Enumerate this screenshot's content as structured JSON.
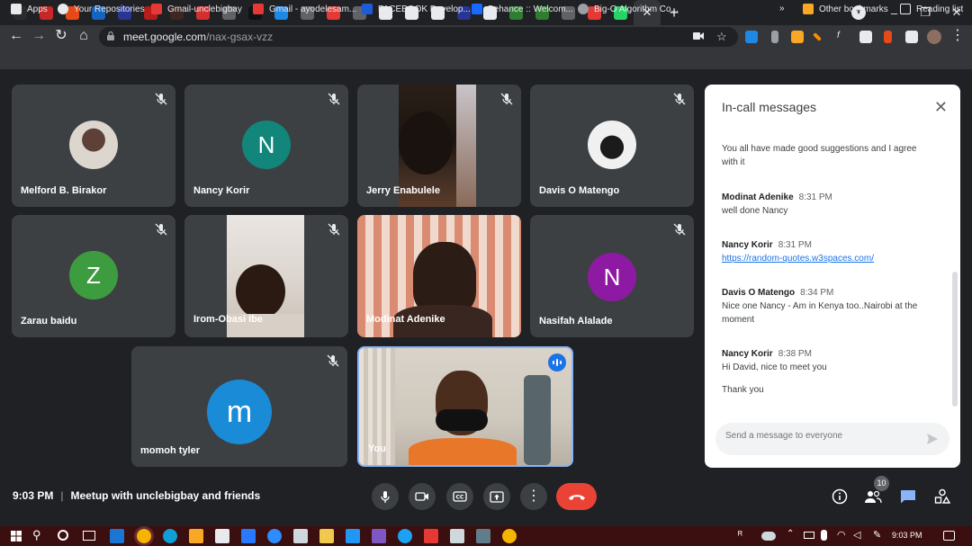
{
  "browser": {
    "tabs": [
      {
        "icon": "b-icon",
        "color": "#2b2b2b"
      },
      {
        "icon": "h-icon",
        "color": "#c62828"
      },
      {
        "icon": "codepen-icon",
        "color": "#e64a19"
      },
      {
        "icon": "jira-icon",
        "color": "#1565c0"
      },
      {
        "icon": "dd-icon",
        "color": "#283593"
      },
      {
        "icon": "record-icon",
        "color": "#b71c1c"
      },
      {
        "icon": "g-icon",
        "color": "#3e2723"
      },
      {
        "icon": "todoist-icon",
        "color": "#d32f2f"
      },
      {
        "icon": "globe-icon",
        "color": "#5f6368"
      },
      {
        "icon": "medium-icon",
        "color": "#111111"
      },
      {
        "icon": "network-icon",
        "color": "#1e88e5"
      },
      {
        "icon": "globe-icon",
        "color": "#5f6368"
      },
      {
        "icon": "youtube-icon",
        "color": "#e53935"
      },
      {
        "icon": "globe-icon",
        "color": "#5f6368"
      },
      {
        "icon": "github-icon",
        "color": "#e8eaed"
      },
      {
        "icon": "card-icon",
        "color": "#e8eaed"
      },
      {
        "icon": "card-icon",
        "color": "#e8eaed"
      },
      {
        "icon": "shield-icon",
        "color": "#283593"
      },
      {
        "icon": "github-icon",
        "color": "#e8eaed"
      },
      {
        "icon": "w-icon",
        "color": "#2e7d32"
      },
      {
        "icon": "w-icon",
        "color": "#2e7d32"
      },
      {
        "icon": "globe-icon",
        "color": "#5f6368"
      },
      {
        "icon": "gmail-icon",
        "color": "#e53935"
      },
      {
        "icon": "whatsapp-icon",
        "color": "#25d366"
      }
    ],
    "url_host": "meet.google.com",
    "url_path": "/nax-gsax-vzz",
    "bookmarks": [
      {
        "label": "Apps",
        "icon": "apps-icon"
      },
      {
        "label": "Your Repositories",
        "icon": "github-icon"
      },
      {
        "label": "Gmail-unclebigbay",
        "icon": "gmail-icon"
      },
      {
        "label": "Gmail - ayodelesam...",
        "icon": "gmail-icon"
      },
      {
        "label": "FACEBOOK Develop...",
        "icon": "facebook-icon"
      },
      {
        "label": "Behance :: Welcom...",
        "icon": "behance-icon"
      },
      {
        "label": "Big-O Algorithm Co...",
        "icon": "globe-icon"
      }
    ],
    "bookmark_overflow": "»",
    "other_bookmarks": "Other bookmarks",
    "reading_list": "Reading list"
  },
  "participants": [
    {
      "name": "Melford B. Birakor",
      "kind": "photo",
      "muted": true
    },
    {
      "name": "Nancy Korir",
      "kind": "initial",
      "initial": "N",
      "color": "#12867a",
      "muted": true
    },
    {
      "name": "Jerry Enabulele",
      "kind": "video",
      "muted": true
    },
    {
      "name": "Davis O Matengo",
      "kind": "photo",
      "muted": true
    },
    {
      "name": "Zarau baidu",
      "kind": "initial",
      "initial": "Z",
      "color": "#3d9c40",
      "muted": true
    },
    {
      "name": "Irom-Obasi Ibe",
      "kind": "video",
      "muted": true
    },
    {
      "name": "Modinat Adenike",
      "kind": "video",
      "muted": false
    },
    {
      "name": "Nasifah Alalade",
      "kind": "initial",
      "initial": "N",
      "color": "#8e1aa3",
      "muted": true
    },
    {
      "name": "momoh tyler",
      "kind": "initial",
      "initial": "m",
      "color": "#1a8bd6",
      "muted": true
    },
    {
      "name": "You",
      "kind": "video",
      "muted": false,
      "speaking": true
    }
  ],
  "chat": {
    "title": "In-call messages",
    "messages": [
      {
        "sender": "",
        "time": "",
        "text": "You all have made good suggestions and I agree with it"
      },
      {
        "sender": "Modinat Adenike",
        "time": "8:31 PM",
        "text": "well done Nancy"
      },
      {
        "sender": "Nancy Korir",
        "time": "8:31 PM",
        "link": "https://random-quotes.w3spaces.com/"
      },
      {
        "sender": "Davis O Matengo",
        "time": "8:34 PM",
        "text": "Nice one Nancy - Am in Kenya too..Nairobi at the moment"
      },
      {
        "sender": "Nancy Korir",
        "time": "8:38 PM",
        "text": "Hi David, nice to meet you"
      },
      {
        "sender": "",
        "time": "",
        "text": "Thank you"
      }
    ],
    "input_placeholder": "Send a message to everyone"
  },
  "meeting": {
    "time": "9:03 PM",
    "title": "Meetup with unclebigbay and friends",
    "people_count": "10"
  },
  "taskbar": {
    "clock": "9:03 PM"
  },
  "colors": {
    "bg": "#202124",
    "tile": "#3c4043",
    "hangup": "#ea4335",
    "accent": "#1a73e8",
    "taskbar": "#3b0f0f"
  }
}
